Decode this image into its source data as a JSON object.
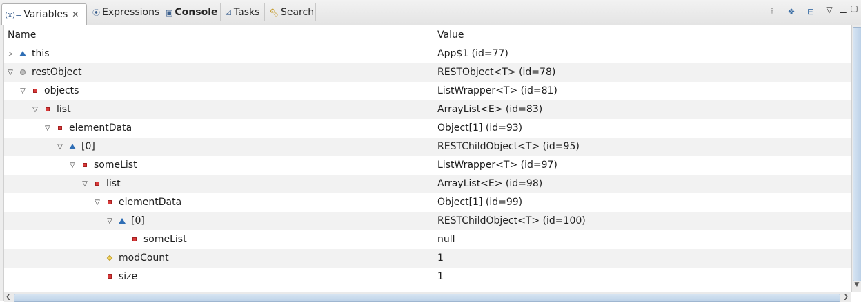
{
  "tabs": [
    {
      "label": "Variables",
      "icon": "variables-icon",
      "active": true
    },
    {
      "label": "Expressions",
      "icon": "expressions-icon"
    },
    {
      "label": "Console",
      "icon": "console-icon",
      "bold": true
    },
    {
      "label": "Tasks",
      "icon": "tasks-icon"
    },
    {
      "label": "Search",
      "icon": "search-icon"
    }
  ],
  "tab_close_glyph": "✕",
  "columns": {
    "name": "Name",
    "value": "Value"
  },
  "rows": [
    {
      "name": "this",
      "value": "App$1  (id=77)",
      "depth": 0,
      "expand": "collapsed",
      "kind": "tri"
    },
    {
      "name": "restObject",
      "value": "RESTObject<T>  (id=78)",
      "depth": 0,
      "expand": "expanded",
      "kind": "circle"
    },
    {
      "name": "objects",
      "value": "ListWrapper<T>  (id=81)",
      "depth": 1,
      "expand": "expanded",
      "kind": "field"
    },
    {
      "name": "list",
      "value": "ArrayList<E>  (id=83)",
      "depth": 2,
      "expand": "expanded",
      "kind": "field"
    },
    {
      "name": "elementData",
      "value": "Object[1]  (id=93)",
      "depth": 3,
      "expand": "expanded",
      "kind": "field"
    },
    {
      "name": "[0]",
      "value": "RESTChildObject<T>  (id=95)",
      "depth": 4,
      "expand": "expanded",
      "kind": "tri"
    },
    {
      "name": "someList",
      "value": "ListWrapper<T>  (id=97)",
      "depth": 5,
      "expand": "expanded",
      "kind": "field"
    },
    {
      "name": "list",
      "value": "ArrayList<E>  (id=98)",
      "depth": 6,
      "expand": "expanded",
      "kind": "field"
    },
    {
      "name": "elementData",
      "value": "Object[1]  (id=99)",
      "depth": 7,
      "expand": "expanded",
      "kind": "field"
    },
    {
      "name": "[0]",
      "value": "RESTChildObject<T>  (id=100)",
      "depth": 8,
      "expand": "expanded",
      "kind": "tri"
    },
    {
      "name": "someList",
      "value": "null",
      "depth": 9,
      "expand": "none",
      "kind": "field"
    },
    {
      "name": "modCount",
      "value": "1",
      "depth": 7,
      "expand": "none",
      "kind": "diamond"
    },
    {
      "name": "size",
      "value": "1",
      "depth": 7,
      "expand": "none",
      "kind": "field"
    }
  ],
  "colors": {
    "accent": "#2f6eb5",
    "field_icon": "#d83a3a",
    "alt_row": "#f2f2f2"
  }
}
